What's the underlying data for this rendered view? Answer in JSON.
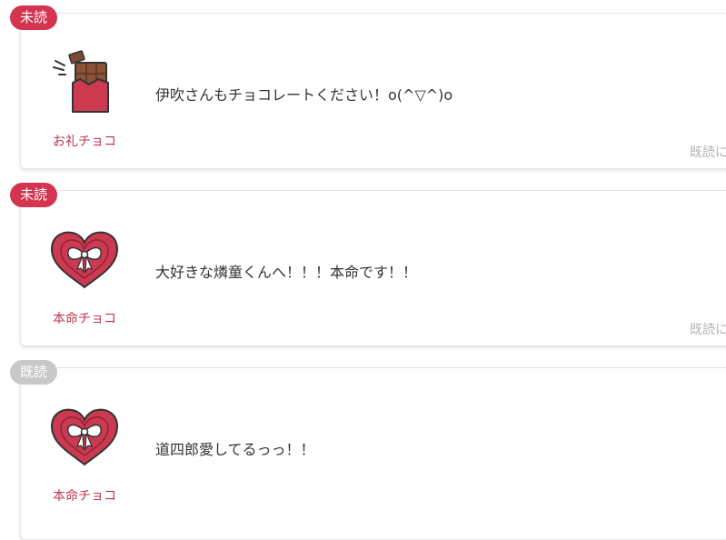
{
  "colors": {
    "unread_badge": "#d4344f",
    "read_badge": "#c8c8c8",
    "label": "#c0334c",
    "heart_fill": "#cc3a52"
  },
  "messages": [
    {
      "status": "未読",
      "icon": "chocolate-bar-icon",
      "choco_type": "お礼チョコ",
      "text": "伊吹さんもチョコレートください！o(^▽^)o",
      "read_hint": "既読に"
    },
    {
      "status": "未読",
      "icon": "heart-box-icon",
      "choco_type": "本命チョコ",
      "text": "大好きな燐童くんへ！！！本命です！！",
      "read_hint": "既読に"
    },
    {
      "status": "既読",
      "icon": "heart-box-icon",
      "choco_type": "本命チョコ",
      "text": "道四郎愛してるっっ！！"
    }
  ]
}
